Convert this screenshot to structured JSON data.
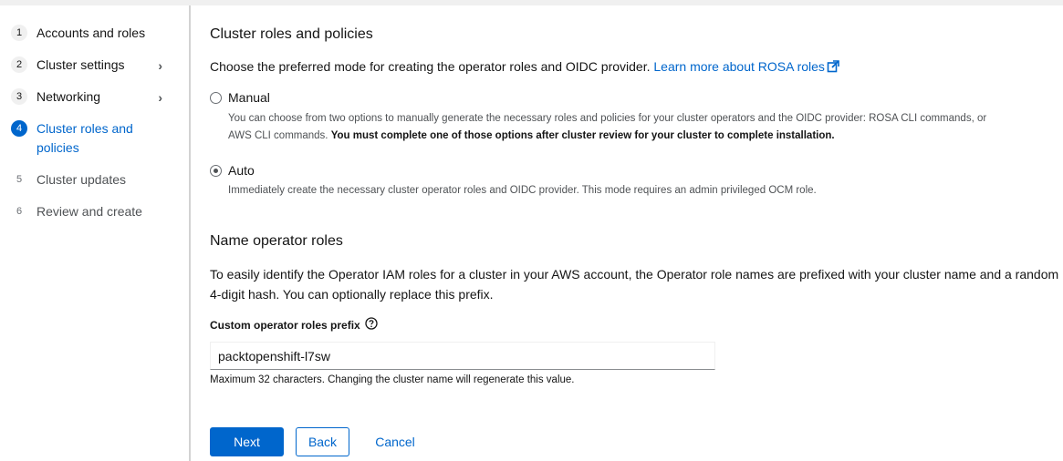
{
  "nav": {
    "steps": [
      {
        "number": "1",
        "label": "Accounts and roles"
      },
      {
        "number": "2",
        "label": "Cluster settings"
      },
      {
        "number": "3",
        "label": "Networking"
      },
      {
        "number": "4",
        "label": "Cluster roles and policies"
      },
      {
        "number": "5",
        "label": "Cluster updates"
      },
      {
        "number": "6",
        "label": "Review and create"
      }
    ],
    "chevron": "›"
  },
  "section1": {
    "title": "Cluster roles and policies",
    "intro": "Choose the preferred mode for creating the operator roles and OIDC provider.",
    "link_text": "Learn more about ROSA roles",
    "options": [
      {
        "label": "Manual",
        "checked": false,
        "desc_line1": "You can choose from two options to manually generate the necessary roles and policies for your cluster operators and the OIDC provider: ROSA CLI commands, or",
        "desc_line2_plain": "AWS CLI commands.",
        "desc_line2_bold": "You must complete one of those options after cluster review for your cluster to complete installation."
      },
      {
        "label": "Auto",
        "checked": true,
        "desc_line1": "Immediately create the necessary cluster operator roles and OIDC provider. This mode requires an admin privileged OCM role."
      }
    ]
  },
  "section2": {
    "title": "Name operator roles",
    "paragraph": "To easily identify the Operator IAM roles for a cluster in your AWS account, the Operator role names are prefixed with your cluster name and a random 4-digit hash. You can optionally replace this prefix.",
    "field_label": "Custom operator roles prefix",
    "field_value": "packtopenshift-l7sw",
    "helper": "Maximum 32 characters. Changing the cluster name will regenerate this value."
  },
  "actions": {
    "next": "Next",
    "back": "Back",
    "cancel": "Cancel"
  },
  "colors": {
    "accent": "#0066cc",
    "text": "#151515",
    "muted": "#4f5255"
  },
  "icons": [
    "external-link-icon",
    "help-circle-icon",
    "chevron-right-icon"
  ]
}
